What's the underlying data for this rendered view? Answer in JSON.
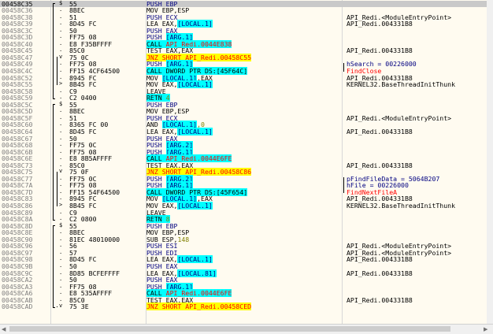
{
  "disasm": {
    "rows": [
      {
        "addr": "00458C35",
        "gut": "$",
        "bytes": "55",
        "instr": [
          {
            "t": "PUSH EBP",
            "c": "push"
          }
        ],
        "cmt": "",
        "sel": true
      },
      {
        "addr": "00458C36",
        "gut": ".",
        "bytes": "8BEC",
        "instr": [
          {
            "t": "MOV EBP,ESP",
            "c": ""
          }
        ],
        "cmt": ""
      },
      {
        "addr": "00458C38",
        "gut": ".",
        "bytes": "51",
        "instr": [
          {
            "t": "PUSH ECX",
            "c": "push"
          }
        ],
        "cmt": "API_Redi.<ModuleEntryPoint>"
      },
      {
        "addr": "00458C39",
        "gut": ".",
        "bytes": "8D45 FC",
        "instr": [
          {
            "t": "LEA EAX,",
            "c": ""
          },
          {
            "t": "[LOCAL.1]",
            "c": "blue"
          }
        ],
        "cmt": "API_Redi.004331B8"
      },
      {
        "addr": "00458C3C",
        "gut": ".",
        "bytes": "50",
        "instr": [
          {
            "t": "PUSH EAX",
            "c": "push"
          }
        ],
        "cmt": ""
      },
      {
        "addr": "00458C3D",
        "gut": ".",
        "bytes": "FF75 08",
        "instr": [
          {
            "t": "PUSH ",
            "c": "push"
          },
          {
            "t": "[ARG.1]",
            "c": "blue"
          }
        ],
        "cmt": ""
      },
      {
        "addr": "00458C40",
        "gut": ".",
        "bytes": "E8 F35BFFFF",
        "instr": [
          {
            "t": "CALL ",
            "c": "call"
          },
          {
            "t": "API_Redi.0044E838",
            "c": "callred"
          }
        ],
        "cmt": ""
      },
      {
        "addr": "00458C45",
        "gut": ".",
        "bytes": "85C0",
        "instr": [
          {
            "t": "TEST EAX,EAX",
            "c": ""
          }
        ],
        "cmt": "API_Redi.004331B8"
      },
      {
        "addr": "00458C47",
        "gut": "v",
        "bytes": "75 0C",
        "instr": [
          {
            "t": "JNZ SHORT API_Redi.00458C55",
            "c": "jmp"
          }
        ],
        "cmt": ""
      },
      {
        "addr": "00458C49",
        "gut": ".",
        "bytes": "FF75 08",
        "instr": [
          {
            "t": "PUSH ",
            "c": "push"
          },
          {
            "t": "[ARG.1]",
            "c": "blue"
          }
        ],
        "cmt": "hSearch = 00226000",
        "cmtc": "navy"
      },
      {
        "addr": "00458C4C",
        "gut": ".",
        "bytes": "FF15 4CF64500",
        "instr": [
          {
            "t": "CALL ",
            "c": "call"
          },
          {
            "t": "DWORD PTR DS:[45F64C]",
            "c": "callplain"
          }
        ],
        "cmt": "FindClose",
        "cmtc": "red"
      },
      {
        "addr": "00458C52",
        "gut": ".",
        "bytes": "8945 FC",
        "instr": [
          {
            "t": "MOV ",
            "c": ""
          },
          {
            "t": "[LOCAL.1]",
            "c": "blue"
          },
          {
            "t": ",EAX",
            "c": ""
          }
        ],
        "cmt": "API_Redi.004331B8"
      },
      {
        "addr": "00458C55",
        "gut": ">",
        "bytes": "8B45 FC",
        "instr": [
          {
            "t": "MOV EAX,",
            "c": ""
          },
          {
            "t": "[LOCAL.1]",
            "c": "blue"
          }
        ],
        "cmt": "KERNEL32.BaseThreadInitThunk"
      },
      {
        "addr": "00458C58",
        "gut": ".",
        "bytes": "C9",
        "instr": [
          {
            "t": "LEAVE",
            "c": ""
          }
        ],
        "cmt": ""
      },
      {
        "addr": "00458C59",
        "gut": ".",
        "bytes": "C2 0400",
        "instr": [
          {
            "t": "RETN ",
            "c": "ret"
          },
          {
            "t": "4",
            "c": "retnum"
          }
        ],
        "cmt": ""
      },
      {
        "addr": "00458C5C",
        "gut": "$",
        "bytes": "55",
        "instr": [
          {
            "t": "PUSH EBP",
            "c": "push"
          }
        ],
        "cmt": ""
      },
      {
        "addr": "00458C5D",
        "gut": ".",
        "bytes": "8BEC",
        "instr": [
          {
            "t": "MOV EBP,ESP",
            "c": ""
          }
        ],
        "cmt": ""
      },
      {
        "addr": "00458C5F",
        "gut": ".",
        "bytes": "51",
        "instr": [
          {
            "t": "PUSH ECX",
            "c": "push"
          }
        ],
        "cmt": "API_Redi.<ModuleEntryPoint>"
      },
      {
        "addr": "00458C60",
        "gut": ".",
        "bytes": "8365 FC 00",
        "instr": [
          {
            "t": "AND ",
            "c": ""
          },
          {
            "t": "[LOCAL.1]",
            "c": "blue"
          },
          {
            "t": ",0",
            "c": "num"
          }
        ],
        "cmt": ""
      },
      {
        "addr": "00458C64",
        "gut": ".",
        "bytes": "8D45 FC",
        "instr": [
          {
            "t": "LEA EAX,",
            "c": ""
          },
          {
            "t": "[LOCAL.1]",
            "c": "blue"
          }
        ],
        "cmt": "API_Redi.004331B8"
      },
      {
        "addr": "00458C67",
        "gut": ".",
        "bytes": "50",
        "instr": [
          {
            "t": "PUSH EAX",
            "c": "push"
          }
        ],
        "cmt": ""
      },
      {
        "addr": "00458C68",
        "gut": ".",
        "bytes": "FF75 0C",
        "instr": [
          {
            "t": "PUSH ",
            "c": "push"
          },
          {
            "t": "[ARG.2]",
            "c": "blue"
          }
        ],
        "cmt": ""
      },
      {
        "addr": "00458C6B",
        "gut": ".",
        "bytes": "FF75 08",
        "instr": [
          {
            "t": "PUSH ",
            "c": "push"
          },
          {
            "t": "[ARG.1]",
            "c": "blue"
          }
        ],
        "cmt": ""
      },
      {
        "addr": "00458C6E",
        "gut": ".",
        "bytes": "E8 8B5AFFFF",
        "instr": [
          {
            "t": "CALL ",
            "c": "call"
          },
          {
            "t": "API_Redi.0044E6FE",
            "c": "callred"
          }
        ],
        "cmt": ""
      },
      {
        "addr": "00458C73",
        "gut": ".",
        "bytes": "85C0",
        "instr": [
          {
            "t": "TEST EAX,EAX",
            "c": ""
          }
        ],
        "cmt": "API_Redi.004331B8"
      },
      {
        "addr": "00458C75",
        "gut": "v",
        "bytes": "75 0F",
        "instr": [
          {
            "t": "JNZ SHORT API_Redi.00458C86",
            "c": "jmp"
          }
        ],
        "cmt": ""
      },
      {
        "addr": "00458C77",
        "gut": ".",
        "bytes": "FF75 0C",
        "instr": [
          {
            "t": "PUSH ",
            "c": "push"
          },
          {
            "t": "[ARG.2]",
            "c": "blue"
          }
        ],
        "cmt": "pFindFileData = 5064B207",
        "cmtc": "navy"
      },
      {
        "addr": "00458C7A",
        "gut": ".",
        "bytes": "FF75 08",
        "instr": [
          {
            "t": "PUSH ",
            "c": "push"
          },
          {
            "t": "[ARG.1]",
            "c": "blue"
          }
        ],
        "cmt": "hFile = 00226000",
        "cmtc": "navy"
      },
      {
        "addr": "00458C7D",
        "gut": ".",
        "bytes": "FF15 54F64500",
        "instr": [
          {
            "t": "CALL ",
            "c": "call"
          },
          {
            "t": "DWORD PTR DS:[45F654]",
            "c": "callplain"
          }
        ],
        "cmt": "FindNextFileA",
        "cmtc": "red"
      },
      {
        "addr": "00458C83",
        "gut": ".",
        "bytes": "8945 FC",
        "instr": [
          {
            "t": "MOV ",
            "c": ""
          },
          {
            "t": "[LOCAL.1]",
            "c": "blue"
          },
          {
            "t": ",EAX",
            "c": ""
          }
        ],
        "cmt": "API_Redi.004331B8"
      },
      {
        "addr": "00458C86",
        "gut": ">",
        "bytes": "8B45 FC",
        "instr": [
          {
            "t": "MOV EAX,",
            "c": ""
          },
          {
            "t": "[LOCAL.1]",
            "c": "blue"
          }
        ],
        "cmt": "KERNEL32.BaseThreadInitThunk"
      },
      {
        "addr": "00458C89",
        "gut": ".",
        "bytes": "C9",
        "instr": [
          {
            "t": "LEAVE",
            "c": ""
          }
        ],
        "cmt": ""
      },
      {
        "addr": "00458C8A",
        "gut": ".",
        "bytes": "C2 0800",
        "instr": [
          {
            "t": "RETN ",
            "c": "ret"
          },
          {
            "t": "8",
            "c": "retnum"
          }
        ],
        "cmt": ""
      },
      {
        "addr": "00458C8D",
        "gut": "$",
        "bytes": "55",
        "instr": [
          {
            "t": "PUSH EBP",
            "c": "push"
          }
        ],
        "cmt": ""
      },
      {
        "addr": "00458C8E",
        "gut": ".",
        "bytes": "8BEC",
        "instr": [
          {
            "t": "MOV EBP,ESP",
            "c": ""
          }
        ],
        "cmt": ""
      },
      {
        "addr": "00458C90",
        "gut": ".",
        "bytes": "81EC 48010000",
        "instr": [
          {
            "t": "SUB ESP,",
            "c": ""
          },
          {
            "t": "148",
            "c": "num"
          }
        ],
        "cmt": ""
      },
      {
        "addr": "00458C96",
        "gut": ".",
        "bytes": "56",
        "instr": [
          {
            "t": "PUSH ESI",
            "c": "push"
          }
        ],
        "cmt": "API_Redi.<ModuleEntryPoint>"
      },
      {
        "addr": "00458C97",
        "gut": ".",
        "bytes": "57",
        "instr": [
          {
            "t": "PUSH EDI",
            "c": "push"
          }
        ],
        "cmt": "API_Redi.<ModuleEntryPoint>"
      },
      {
        "addr": "00458C98",
        "gut": ".",
        "bytes": "8D45 FC",
        "instr": [
          {
            "t": "LEA EAX,",
            "c": ""
          },
          {
            "t": "[LOCAL.1]",
            "c": "blue"
          }
        ],
        "cmt": "API_Redi.004331B8"
      },
      {
        "addr": "00458C9B",
        "gut": ".",
        "bytes": "50",
        "instr": [
          {
            "t": "PUSH EAX",
            "c": "push"
          }
        ],
        "cmt": ""
      },
      {
        "addr": "00458C9C",
        "gut": ".",
        "bytes": "8D85 BCFEFFFF",
        "instr": [
          {
            "t": "LEA EAX,",
            "c": ""
          },
          {
            "t": "[LOCAL.81]",
            "c": "blue"
          }
        ],
        "cmt": "API_Redi.004331B8"
      },
      {
        "addr": "00458CA2",
        "gut": ".",
        "bytes": "50",
        "instr": [
          {
            "t": "PUSH EAX",
            "c": "push"
          }
        ],
        "cmt": ""
      },
      {
        "addr": "00458CA3",
        "gut": ".",
        "bytes": "FF75 08",
        "instr": [
          {
            "t": "PUSH ",
            "c": "push"
          },
          {
            "t": "[ARG.1]",
            "c": "blue"
          }
        ],
        "cmt": ""
      },
      {
        "addr": "00458CA6",
        "gut": ".",
        "bytes": "E8 535AFFFF",
        "instr": [
          {
            "t": "CALL ",
            "c": "call"
          },
          {
            "t": "API_Redi.0044E6FE",
            "c": "callred"
          }
        ],
        "cmt": ""
      },
      {
        "addr": "00458CAB",
        "gut": ".",
        "bytes": "85C0",
        "instr": [
          {
            "t": "TEST EAX,EAX",
            "c": ""
          }
        ],
        "cmt": "API_Redi.004331B8"
      },
      {
        "addr": "00458CAD",
        "gut": "v",
        "bytes": "75 3E",
        "instr": [
          {
            "t": "JNZ SHORT API_Redi.00458CED",
            "c": "jmp"
          }
        ],
        "cmt": ""
      }
    ]
  },
  "scrollbar": {
    "left_arrow": "◀",
    "right_arrow": "▶"
  },
  "colors": {
    "background": "#fffbf0",
    "highlight_cyan": "#00ffff",
    "highlight_yellow": "#ffff00",
    "jump_red": "#ff0000",
    "comment_red": "#ff0000",
    "push_navy": "#000080",
    "selection": "#c9c9c9"
  }
}
